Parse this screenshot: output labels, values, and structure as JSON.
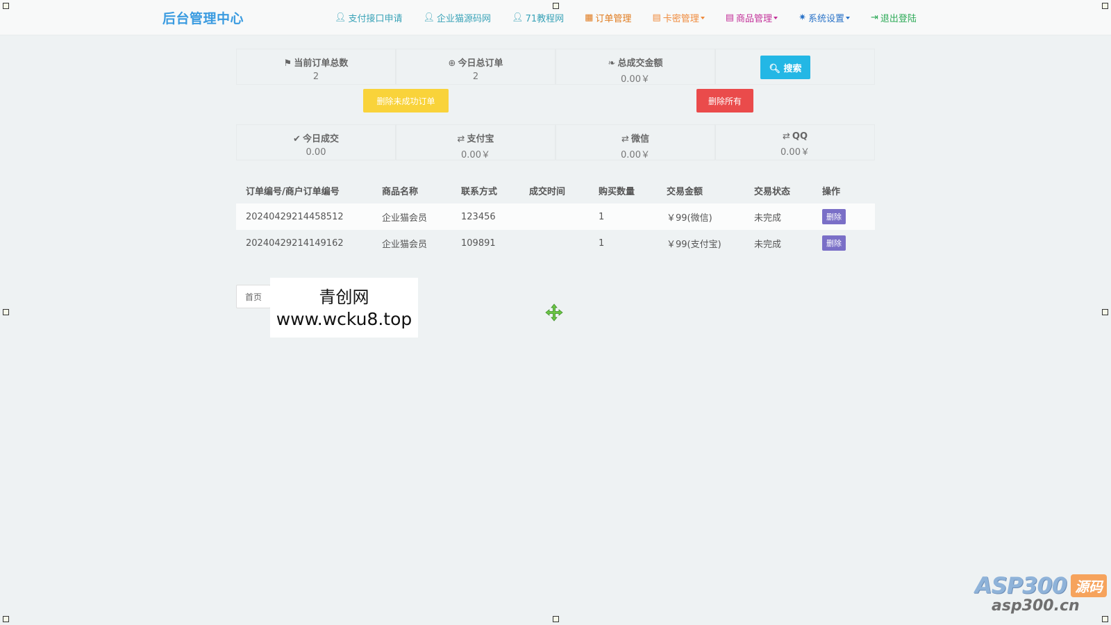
{
  "app_title": "后台管理中心",
  "nav": [
    {
      "label": "支付接口申请",
      "icon": "user-icon",
      "color": "#3aa3b8",
      "caret": false
    },
    {
      "label": "企业猫源码网",
      "icon": "user-icon",
      "color": "#3aa3b8",
      "caret": false
    },
    {
      "label": "71教程网",
      "icon": "user-icon",
      "color": "#3aa3b8",
      "caret": false
    },
    {
      "label": "订单管理",
      "icon": "calendar-icon",
      "color": "#e07b1f",
      "caret": false
    },
    {
      "label": "卡密管理",
      "icon": "book-icon",
      "color": "#ef8a3c",
      "caret": true
    },
    {
      "label": "商品管理",
      "icon": "book-icon",
      "color": "#c3329a",
      "caret": true
    },
    {
      "label": "系统设置",
      "icon": "gear-icon",
      "color": "#2a73c8",
      "caret": true
    },
    {
      "label": "退出登陆",
      "icon": "sign-out-icon",
      "color": "#2daa57",
      "caret": false
    }
  ],
  "stats_top": [
    {
      "label": "当前订单总数",
      "value": "2",
      "icon": "flag-icon"
    },
    {
      "label": "今日总订单",
      "value": "2",
      "icon": "plus-circle-icon"
    },
    {
      "label": "总成交金额",
      "value": "0.00￥",
      "icon": "leaf-icon"
    }
  ],
  "search_button": "搜索",
  "delete_failed_button": "删除未成功订单",
  "delete_all_button": "删除所有",
  "stats_bottom": [
    {
      "label": "今日成交",
      "value": "0.00",
      "icon": "check-icon"
    },
    {
      "label": "支付宝",
      "value": "0.00￥",
      "icon": "retweet-icon"
    },
    {
      "label": "微信",
      "value": "0.00￥",
      "icon": "retweet-icon"
    },
    {
      "label": "QQ",
      "value": "0.00￥",
      "icon": "retweet-icon"
    }
  ],
  "table": {
    "headers": [
      "订单编号/商户订单编号",
      "商品名称",
      "联系方式",
      "成交时间",
      "购买数量",
      "交易金额",
      "交易状态",
      "操作"
    ],
    "rows": [
      {
        "order_no": "20240429214458512",
        "product": "企业猫会员",
        "contact": "123456",
        "time": "",
        "qty": "1",
        "amount": "￥99(微信)",
        "status": "未完成",
        "action": "删除"
      },
      {
        "order_no": "20240429214149162",
        "product": "企业猫会员",
        "contact": "109891",
        "time": "",
        "qty": "1",
        "amount": "￥99(支付宝)",
        "status": "未完成",
        "action": "删除"
      }
    ]
  },
  "pager_first": "首页",
  "watermark": {
    "line1": "青创网",
    "line2": "www.wcku8.top"
  },
  "logo": {
    "main": "ASP300",
    "tag": "源码",
    "url": "asp300.cn"
  }
}
